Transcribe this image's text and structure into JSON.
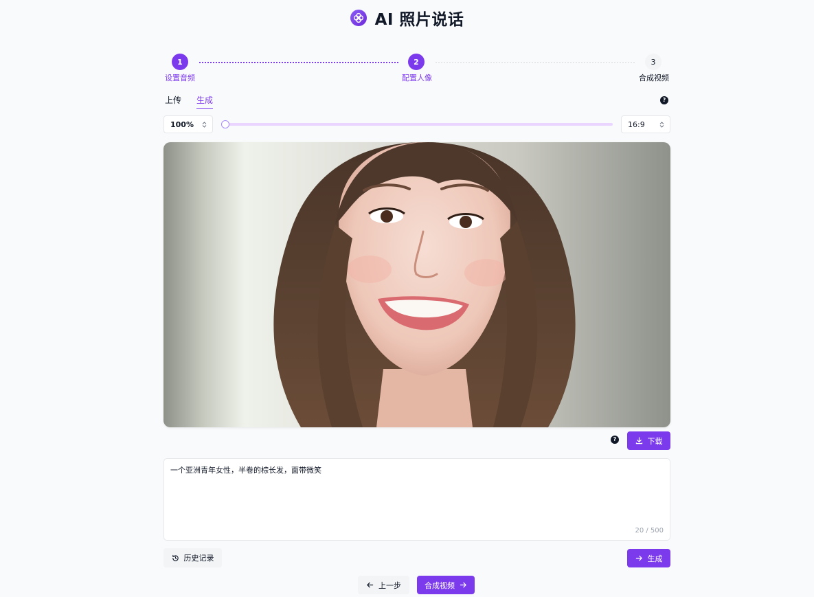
{
  "app": {
    "title": "AI 照片说话"
  },
  "stepper": {
    "steps": [
      {
        "number": "1",
        "label": "设置音频",
        "state": "done"
      },
      {
        "number": "2",
        "label": "配置人像",
        "state": "active"
      },
      {
        "number": "3",
        "label": "合成视频",
        "state": "todo"
      }
    ]
  },
  "tabs": [
    {
      "label": "上传",
      "active": false
    },
    {
      "label": "生成",
      "active": true
    }
  ],
  "controls": {
    "zoom_value": "100%",
    "zoom_slider_fraction": 0,
    "aspect_value": "16:9"
  },
  "image_actions": {
    "download_label": "下载"
  },
  "prompt": {
    "value": "一个亚洲青年女性，半卷的棕长发，面带微笑",
    "char_count": "20 / 500"
  },
  "actions": {
    "history_label": "历史记录",
    "generate_label": "生成",
    "prev_label": "上一步",
    "compose_label": "合成视频"
  },
  "colors": {
    "accent": "#7c3aed",
    "accent_light": "#e9d5ff",
    "background": "#f9fafb"
  }
}
